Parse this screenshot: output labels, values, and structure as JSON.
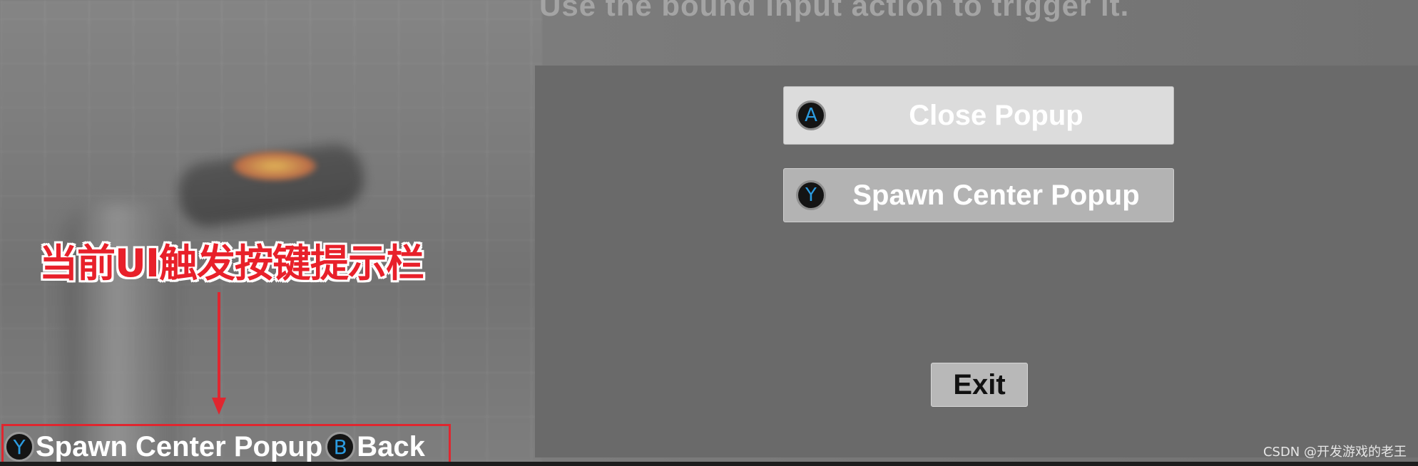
{
  "header": {
    "instruction": "Use the bound input action to trigger it."
  },
  "popup": {
    "buttons": [
      {
        "glyph": "A",
        "label": "Close Popup"
      },
      {
        "glyph": "Y",
        "label": "Spawn Center Popup"
      }
    ],
    "exit_label": "Exit"
  },
  "annotation": {
    "text": "当前UI触发按键提示栏",
    "color": "#e8202a"
  },
  "hint_bar": {
    "items": [
      {
        "glyph": "Y",
        "label": "Spawn Center Popup"
      },
      {
        "glyph": "B",
        "label": "Back"
      }
    ]
  },
  "watermark": "CSDN @开发游戏的老王",
  "colors": {
    "gamepad_glyph": "#2b9be0",
    "highlight_red": "#e0262f"
  }
}
